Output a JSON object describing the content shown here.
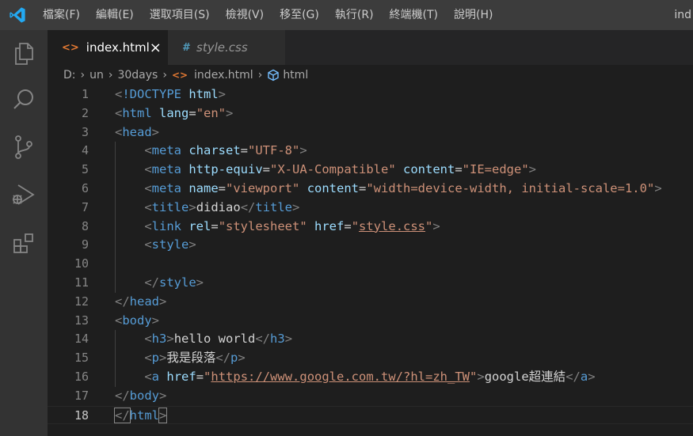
{
  "menu": [
    "檔案(F)",
    "編輯(E)",
    "選取項目(S)",
    "檢視(V)",
    "移至(G)",
    "執行(R)",
    "終端機(T)",
    "說明(H)"
  ],
  "window_title": "ind",
  "tabs": [
    {
      "label": "index.html",
      "icon": "<>",
      "close": "×"
    },
    {
      "label": "style.css",
      "icon": "#"
    }
  ],
  "breadcrumb": {
    "items": [
      "D:",
      "un",
      "30days",
      "index.html",
      "html"
    ],
    "separator": "›"
  },
  "editor": {
    "current_line": 18,
    "lines": [
      {
        "n": "1",
        "tokens": [
          [
            "br",
            "<"
          ],
          [
            "tag",
            "!DOCTYPE"
          ],
          [
            "txt",
            " "
          ],
          [
            "attr",
            "html"
          ],
          [
            "br",
            ">"
          ]
        ]
      },
      {
        "n": "2",
        "tokens": [
          [
            "br",
            "<"
          ],
          [
            "tag",
            "html"
          ],
          [
            "txt",
            " "
          ],
          [
            "attr",
            "lang"
          ],
          [
            "txt",
            "="
          ],
          [
            "str",
            "\"en\""
          ],
          [
            "br",
            ">"
          ]
        ]
      },
      {
        "n": "3",
        "tokens": [
          [
            "br",
            "<"
          ],
          [
            "tag",
            "head"
          ],
          [
            "br",
            ">"
          ]
        ]
      },
      {
        "n": "4",
        "tokens": [
          [
            "txt",
            "    "
          ],
          [
            "br",
            "<"
          ],
          [
            "tag",
            "meta"
          ],
          [
            "txt",
            " "
          ],
          [
            "attr",
            "charset"
          ],
          [
            "txt",
            "="
          ],
          [
            "str",
            "\"UTF-8\""
          ],
          [
            "br",
            ">"
          ]
        ]
      },
      {
        "n": "5",
        "tokens": [
          [
            "txt",
            "    "
          ],
          [
            "br",
            "<"
          ],
          [
            "tag",
            "meta"
          ],
          [
            "txt",
            " "
          ],
          [
            "attr",
            "http-equiv"
          ],
          [
            "txt",
            "="
          ],
          [
            "str",
            "\"X-UA-Compatible\""
          ],
          [
            "txt",
            " "
          ],
          [
            "attr",
            "content"
          ],
          [
            "txt",
            "="
          ],
          [
            "str",
            "\"IE=edge\""
          ],
          [
            "br",
            ">"
          ]
        ]
      },
      {
        "n": "6",
        "tokens": [
          [
            "txt",
            "    "
          ],
          [
            "br",
            "<"
          ],
          [
            "tag",
            "meta"
          ],
          [
            "txt",
            " "
          ],
          [
            "attr",
            "name"
          ],
          [
            "txt",
            "="
          ],
          [
            "str",
            "\"viewport\""
          ],
          [
            "txt",
            " "
          ],
          [
            "attr",
            "content"
          ],
          [
            "txt",
            "="
          ],
          [
            "str",
            "\"width=device-width, initial-scale=1.0\""
          ],
          [
            "br",
            ">"
          ]
        ]
      },
      {
        "n": "7",
        "tokens": [
          [
            "txt",
            "    "
          ],
          [
            "br",
            "<"
          ],
          [
            "tag",
            "title"
          ],
          [
            "br",
            ">"
          ],
          [
            "txt",
            "didiao"
          ],
          [
            "br",
            "</"
          ],
          [
            "tag",
            "title"
          ],
          [
            "br",
            ">"
          ]
        ]
      },
      {
        "n": "8",
        "tokens": [
          [
            "txt",
            "    "
          ],
          [
            "br",
            "<"
          ],
          [
            "tag",
            "link"
          ],
          [
            "txt",
            " "
          ],
          [
            "attr",
            "rel"
          ],
          [
            "txt",
            "="
          ],
          [
            "str",
            "\"stylesheet\""
          ],
          [
            "txt",
            " "
          ],
          [
            "attr",
            "href"
          ],
          [
            "txt",
            "="
          ],
          [
            "str",
            "\""
          ],
          [
            "strlink",
            "style.css"
          ],
          [
            "str",
            "\""
          ],
          [
            "br",
            ">"
          ]
        ]
      },
      {
        "n": "9",
        "tokens": [
          [
            "txt",
            "    "
          ],
          [
            "br",
            "<"
          ],
          [
            "tag",
            "style"
          ],
          [
            "br",
            ">"
          ]
        ]
      },
      {
        "n": "10",
        "tokens": []
      },
      {
        "n": "11",
        "tokens": [
          [
            "txt",
            "    "
          ],
          [
            "br",
            "</"
          ],
          [
            "tag",
            "style"
          ],
          [
            "br",
            ">"
          ]
        ]
      },
      {
        "n": "12",
        "tokens": [
          [
            "br",
            "</"
          ],
          [
            "tag",
            "head"
          ],
          [
            "br",
            ">"
          ]
        ]
      },
      {
        "n": "13",
        "tokens": [
          [
            "br",
            "<"
          ],
          [
            "tag",
            "body"
          ],
          [
            "br",
            ">"
          ]
        ]
      },
      {
        "n": "14",
        "tokens": [
          [
            "txt",
            "    "
          ],
          [
            "br",
            "<"
          ],
          [
            "tag",
            "h3"
          ],
          [
            "br",
            ">"
          ],
          [
            "txt",
            "hello world"
          ],
          [
            "br",
            "</"
          ],
          [
            "tag",
            "h3"
          ],
          [
            "br",
            ">"
          ]
        ]
      },
      {
        "n": "15",
        "tokens": [
          [
            "txt",
            "    "
          ],
          [
            "br",
            "<"
          ],
          [
            "tag",
            "p"
          ],
          [
            "br",
            ">"
          ],
          [
            "txt",
            "我是段落"
          ],
          [
            "br",
            "</"
          ],
          [
            "tag",
            "p"
          ],
          [
            "br",
            ">"
          ]
        ]
      },
      {
        "n": "16",
        "tokens": [
          [
            "txt",
            "    "
          ],
          [
            "br",
            "<"
          ],
          [
            "tag",
            "a"
          ],
          [
            "txt",
            " "
          ],
          [
            "attr",
            "href"
          ],
          [
            "txt",
            "="
          ],
          [
            "str",
            "\""
          ],
          [
            "strlink",
            "https://www.google.com.tw/?hl=zh_TW"
          ],
          [
            "str",
            "\""
          ],
          [
            "br",
            ">"
          ],
          [
            "txt",
            "google超連結"
          ],
          [
            "br",
            "</"
          ],
          [
            "tag",
            "a"
          ],
          [
            "br",
            ">"
          ]
        ]
      },
      {
        "n": "17",
        "tokens": [
          [
            "br",
            "</"
          ],
          [
            "tag",
            "body"
          ],
          [
            "br",
            ">"
          ]
        ]
      },
      {
        "n": "18",
        "tokens": [
          [
            "brm",
            "</"
          ],
          [
            "tag",
            "html"
          ],
          [
            "brm",
            ">"
          ]
        ]
      }
    ]
  },
  "colors": {
    "titlebar": "#3c3c3c",
    "activitybar": "#333333",
    "editor_bg": "#1e1e1e",
    "tag": "#569cd6",
    "attr": "#9cdcfe",
    "string": "#ce9178",
    "html_icon": "#e37933",
    "css_icon": "#519aba",
    "vscode_blue": "#23a9f2"
  },
  "icons": {
    "logo": "vscode-logo-icon",
    "activity": [
      "explorer-icon",
      "search-icon",
      "source-control-icon",
      "run-debug-icon",
      "extensions-icon"
    ],
    "breadcrumb_file": "html-file-icon",
    "breadcrumb_symbol": "symbol-element-icon"
  }
}
